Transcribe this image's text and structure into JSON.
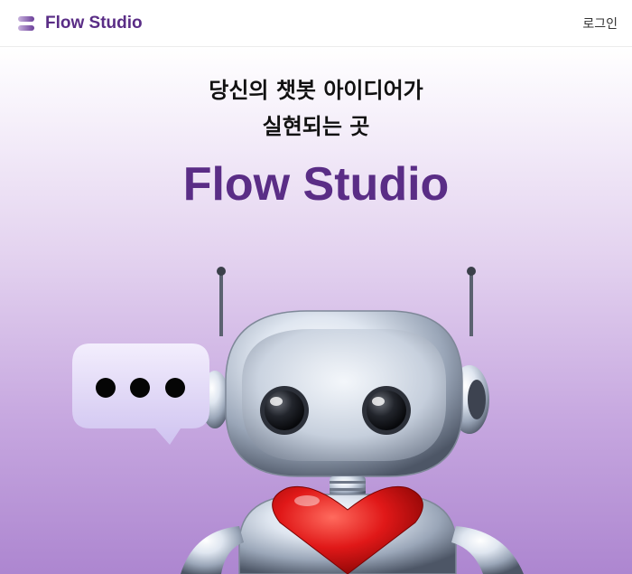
{
  "navbar": {
    "brand_name": "Flow Studio",
    "logo_icon": "flow-logo-icon",
    "login_label": "로그인"
  },
  "hero": {
    "headline_line1": "당신의 챗봇 아이디어가",
    "headline_line2": "실현되는 곳",
    "title": "Flow Studio"
  },
  "illustration": {
    "robot": "robot-illustration",
    "speech_bubble": "speech-bubble-icon",
    "heart": "heart-icon"
  },
  "colors": {
    "brand": "#5a2d86",
    "gradient_bottom": "#ad86d0"
  }
}
